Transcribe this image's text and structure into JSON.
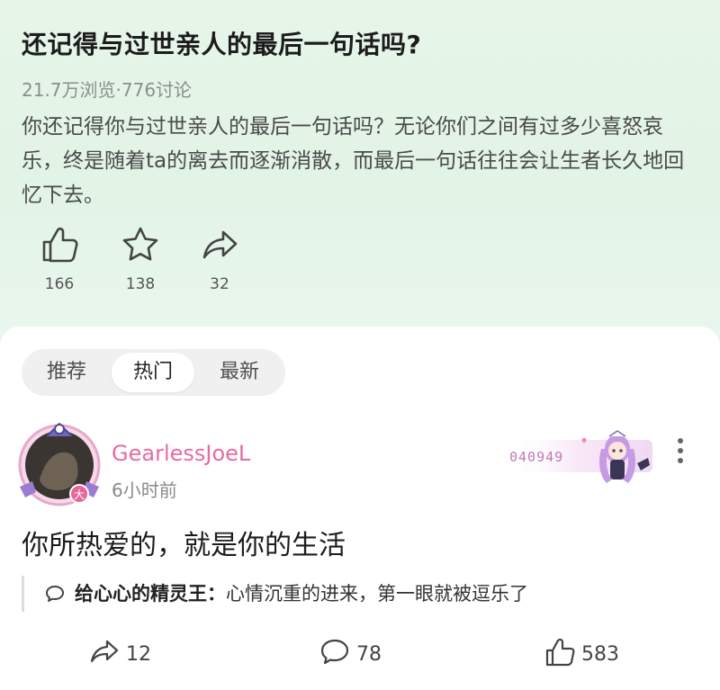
{
  "question": {
    "title": "还记得与过世亲人的最后一句话吗?",
    "stats": "21.7万浏览·776讨论",
    "description": "你还记得你与过世亲人的最后一句话吗？无论你们之间有过多少喜怒哀乐，终是随着ta的离去而逐渐消散，而最后一句话往往会让生者长久地回忆下去。",
    "actions": {
      "like": {
        "icon": "thumbs-up-icon",
        "count": "166"
      },
      "favorite": {
        "icon": "star-icon",
        "count": "138"
      },
      "share": {
        "icon": "share-icon",
        "count": "32"
      }
    }
  },
  "tabs": [
    {
      "label": "推荐",
      "active": false
    },
    {
      "label": "热门",
      "active": true
    },
    {
      "label": "最新",
      "active": false
    }
  ],
  "comment": {
    "username": "GearlessJoeL",
    "time": "6小时前",
    "avatar_tag": "大",
    "badge_code": "040949",
    "text": "你所热爱的，就是你的生活",
    "reply": {
      "name": "给心心的精灵王：",
      "text": "心情沉重的进来，第一眼就被逗乐了"
    },
    "footer": {
      "share_count": "12",
      "comment_count": "78",
      "like_count": "583"
    }
  },
  "colors": {
    "username": "#e86aa5",
    "header_bg": "#e4f5e8",
    "muted_text": "#8a8f8c"
  }
}
